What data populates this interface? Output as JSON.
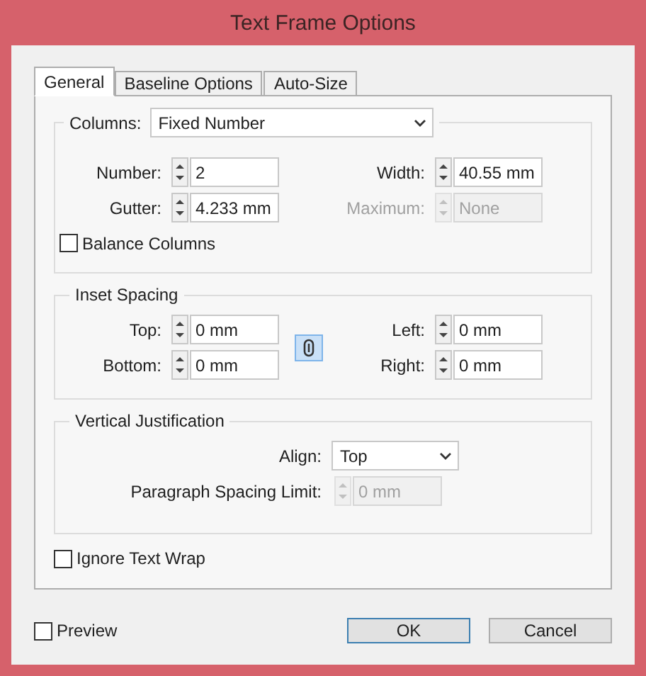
{
  "window": {
    "title": "Text Frame Options"
  },
  "tabs": [
    {
      "label": "General",
      "selected": true
    },
    {
      "label": "Baseline Options",
      "selected": false
    },
    {
      "label": "Auto-Size",
      "selected": false
    }
  ],
  "columns": {
    "label": "Columns:",
    "dropdown": "Fixed Number",
    "fields": [
      {
        "label": "Number:",
        "value": "2",
        "disabled": false
      },
      {
        "label": "Width:",
        "value": "40.55 mm",
        "disabled": false
      },
      {
        "label": "Gutter:",
        "value": "4.233 mm",
        "disabled": false
      },
      {
        "label": "Maximum:",
        "value": "None",
        "disabled": true
      }
    ],
    "balance": {
      "label": "Balance Columns",
      "checked": false
    }
  },
  "inset": {
    "title": "Inset Spacing",
    "linked": true,
    "fields": [
      {
        "label": "Top:",
        "value": "0 mm",
        "disabled": false
      },
      {
        "label": "Left:",
        "value": "0 mm",
        "disabled": false
      },
      {
        "label": "Bottom:",
        "value": "0 mm",
        "disabled": false
      },
      {
        "label": "Right:",
        "value": "0 mm",
        "disabled": false
      }
    ]
  },
  "vertical": {
    "title": "Vertical Justification",
    "align": {
      "label": "Align:",
      "value": "Top"
    },
    "spacing_limit": {
      "label": "Paragraph Spacing Limit:",
      "value": "0 mm",
      "disabled": true
    }
  },
  "ignore_wrap": {
    "label": "Ignore Text Wrap",
    "checked": false
  },
  "preview": {
    "label": "Preview",
    "checked": false
  },
  "buttons": [
    {
      "label": "OK",
      "default": true
    },
    {
      "label": "Cancel",
      "default": false
    }
  ]
}
